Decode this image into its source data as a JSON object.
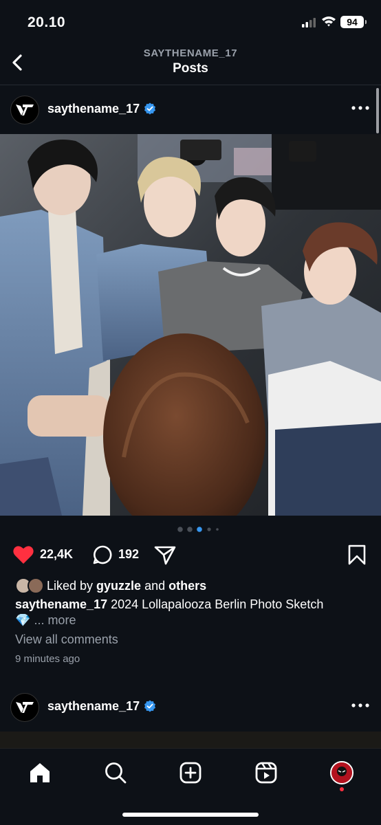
{
  "status_bar": {
    "time": "20.10",
    "battery": "94"
  },
  "header": {
    "account": "SAYTHENAME_17",
    "title": "Posts"
  },
  "post": {
    "username": "saythename_17",
    "likes": "22,4K",
    "comments": "192",
    "liked_by_prefix": "Liked by",
    "liked_by_user": "gyuzzle",
    "liked_by_and": "and",
    "liked_by_others": "others",
    "caption_user": "saythename_17",
    "caption_text": "2024 Lollapalooza Berlin Photo Sketch",
    "caption_emoji": "💎",
    "caption_more": "... more",
    "view_comments": "View all comments",
    "time_ago": "9 minutes ago",
    "carousel": {
      "count": 5,
      "active": 3
    }
  },
  "next_post": {
    "username": "saythename_17"
  },
  "icons": [
    "back-icon",
    "more-icon",
    "verified-icon",
    "heart-icon",
    "comment-icon",
    "share-icon",
    "bookmark-icon",
    "home-icon",
    "search-icon",
    "create-icon",
    "reels-icon",
    "profile-icon"
  ],
  "colors": {
    "background": "#0d1117",
    "like_red": "#ff3040",
    "verified_blue": "#3797f0",
    "secondary_text": "#9aa1ab"
  }
}
